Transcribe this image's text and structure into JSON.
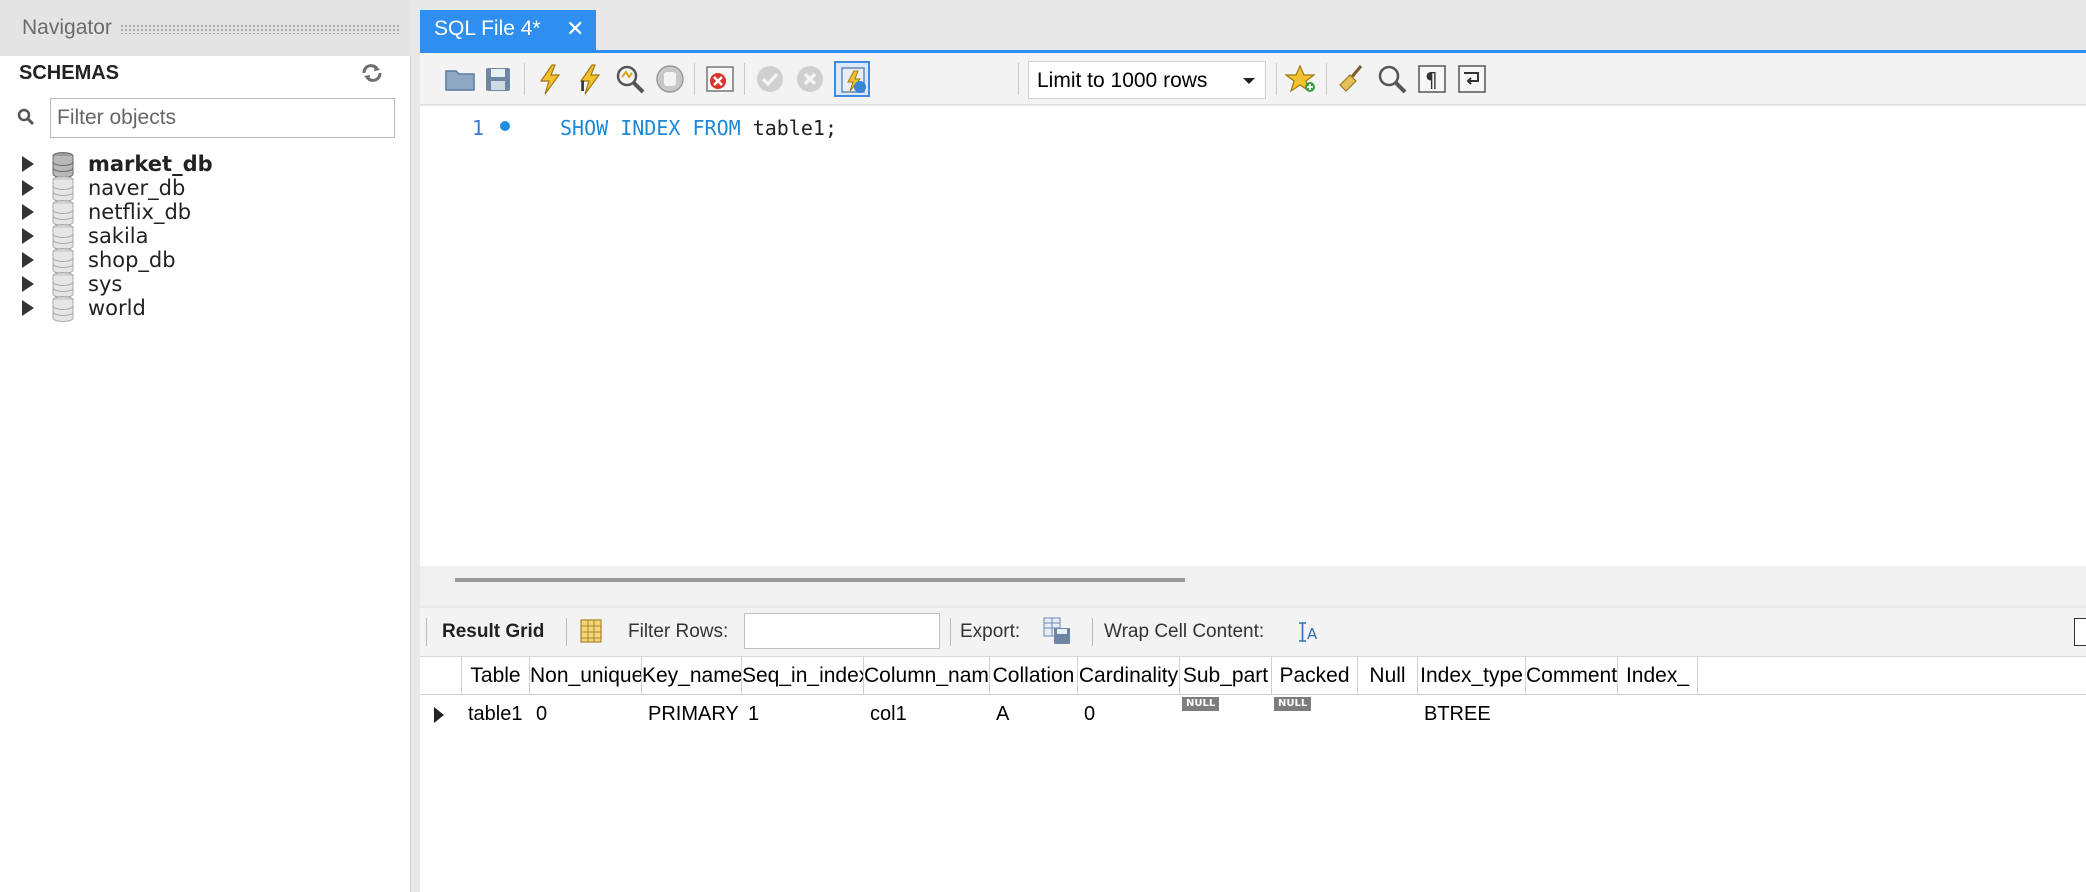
{
  "navigator": {
    "title": "Navigator",
    "schemas_label": "SCHEMAS",
    "filter_placeholder": "Filter objects",
    "schemas": [
      {
        "name": "market_db",
        "bold": true
      },
      {
        "name": "naver_db",
        "bold": false
      },
      {
        "name": "netflix_db",
        "bold": false
      },
      {
        "name": "sakila",
        "bold": false
      },
      {
        "name": "shop_db",
        "bold": false
      },
      {
        "name": "sys",
        "bold": false
      },
      {
        "name": "world",
        "bold": false
      }
    ]
  },
  "tab": {
    "label": "SQL File 4*",
    "close": "✕"
  },
  "toolbar": {
    "icons": [
      "open-folder-icon",
      "save-icon",
      "execute-icon",
      "execute-current-icon",
      "explain-icon",
      "stop-icon",
      "toggle-error-icon",
      "commit-icon",
      "rollback-icon",
      "autocommit-icon",
      "bookmark-icon",
      "beautify-icon",
      "find-icon",
      "invisible-chars-icon",
      "wrap-icon"
    ],
    "limit_label": "Limit to 1000 rows"
  },
  "editor": {
    "line_number": "1",
    "sql_tokens": [
      {
        "text": "SHOW",
        "type": "kw"
      },
      {
        "text": " ",
        "type": "ident"
      },
      {
        "text": "INDEX",
        "type": "kw"
      },
      {
        "text": " ",
        "type": "ident"
      },
      {
        "text": "FROM",
        "type": "kw"
      },
      {
        "text": " table1;",
        "type": "ident"
      }
    ]
  },
  "result_toolbar": {
    "result_grid": "Result Grid",
    "filter_rows": "Filter Rows:",
    "export": "Export:",
    "wrap": "Wrap Cell Content:"
  },
  "grid": {
    "columns": [
      "Table",
      "Non_unique",
      "Key_name",
      "Seq_in_index",
      "Column_name",
      "Collation",
      "Cardinality",
      "Sub_part",
      "Packed",
      "Null",
      "Index_type",
      "Comment",
      "Index_"
    ],
    "rows": [
      [
        "table1",
        "0",
        "PRIMARY",
        "1",
        "col1",
        "A",
        "0",
        "NULL",
        "NULL",
        "",
        "BTREE",
        "",
        ""
      ]
    ]
  },
  "colors": {
    "accent": "#2e8ff0",
    "keyword": "#1c88d8"
  }
}
